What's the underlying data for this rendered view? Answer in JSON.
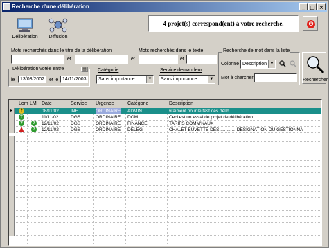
{
  "window": {
    "title": "Recherche d'une délibération",
    "buttons": {
      "minimize": "_",
      "maximize": "□",
      "close": "×"
    }
  },
  "toolbar": {
    "deliberation_label": "Délibération",
    "diffusion_label": "Diffusion"
  },
  "banner": "4 projet(s) correspond(ent) à votre recherche.",
  "search_title": {
    "label": "Mots recherchés dans le titre de la délibération",
    "et1": "et",
    "et2": "et",
    "value1": "",
    "value2": "",
    "value3": ""
  },
  "search_text": {
    "label": "Mots recherchés dans le texte",
    "et": "et",
    "value1": "",
    "value2": ""
  },
  "search_list": {
    "label": "Recherche de mot dans la liste",
    "colonne_label": "Colonne",
    "colonne_value": "Description",
    "mot_label": "Mot à chercher",
    "mot_value": ""
  },
  "dates": {
    "label": "Délibération votée entre",
    "le_label": "le",
    "et_label": "et le",
    "from": "13/03/2002",
    "to": "14/11/2003"
  },
  "categorie": {
    "label": "Catégorie",
    "value": "Sans importance"
  },
  "service": {
    "label": "Service demandeur",
    "value": "Sans importance"
  },
  "rechercher_label": "Rechercher",
  "table": {
    "headers": [
      "Lom",
      "LM",
      "Date",
      "Service",
      "Urgence",
      "Catégorie",
      "Description"
    ],
    "rows": [
      {
        "marker": "▸",
        "date": "08/11/02",
        "service": "INF",
        "urgence": "ORDINAIRE",
        "categorie": "ADMIN",
        "description": "vraiment pour le test des délib"
      },
      {
        "marker": "",
        "date": "11/11/02",
        "service": "DGS",
        "urgence": "ORDINAIRE",
        "categorie": "DOM",
        "description": "Ceci est un essai de projet de délibération"
      },
      {
        "marker": "",
        "date": "12/11/02",
        "service": "DGS",
        "urgence": "ORDINAIRE",
        "categorie": "FINANCE",
        "description": "TARIFS COMM'NAUX"
      },
      {
        "marker": "",
        "date": "12/11/02",
        "service": "DGS",
        "urgence": "ORDINAIRE",
        "categorie": "DELEG",
        "description": "CHALET BUVETTE DES ............ DESIGNATION DU GESTIONNA"
      }
    ]
  },
  "colors": {
    "selected_row": "#1a8f8a",
    "status_ok": "#2e9a2e",
    "warning": "#d02020",
    "title_bar": "#0a246a"
  }
}
